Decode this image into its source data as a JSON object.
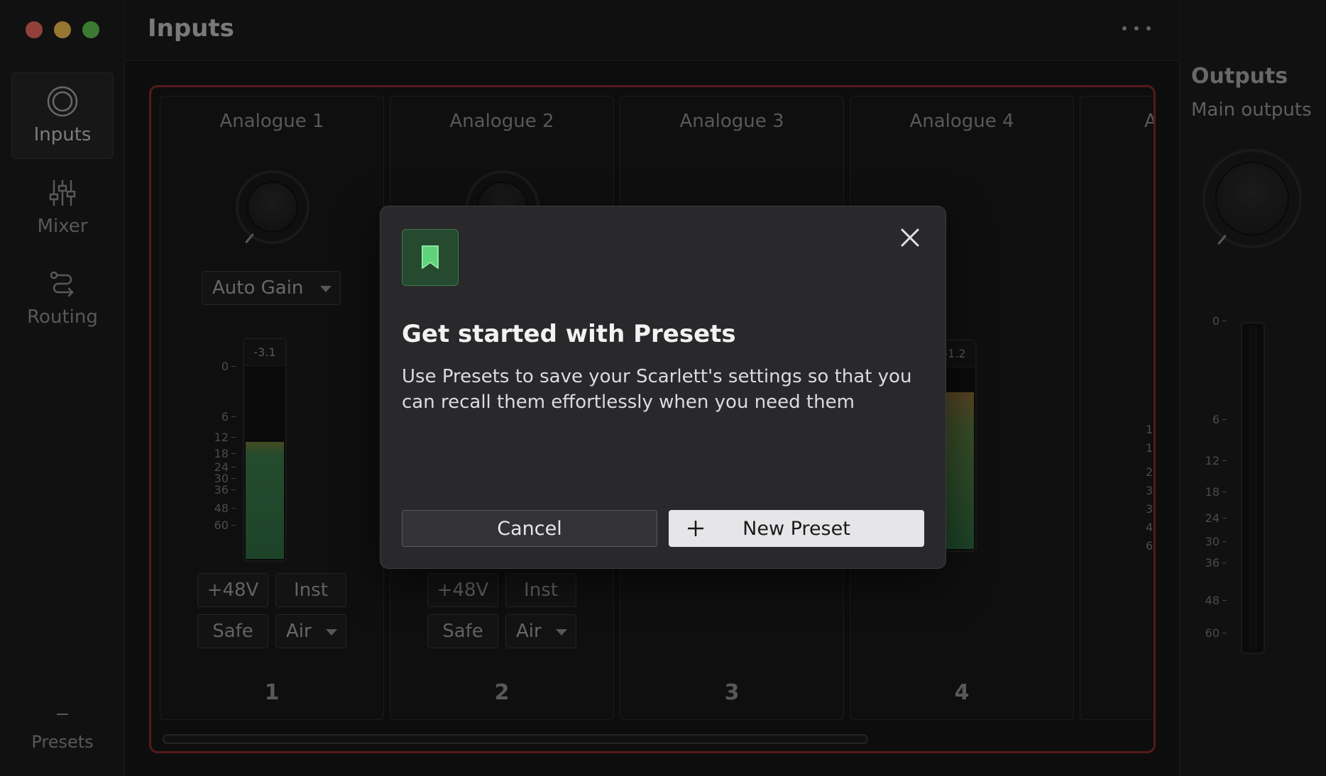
{
  "header": {
    "title": "Inputs"
  },
  "sidebar": {
    "items": [
      {
        "label": "Inputs",
        "icon": "inputs-icon",
        "active": true
      },
      {
        "label": "Mixer",
        "icon": "mixer-icon",
        "active": false
      },
      {
        "label": "Routing",
        "icon": "routing-icon",
        "active": false
      }
    ],
    "presets_label": "Presets"
  },
  "channels": [
    {
      "title": "Analogue 1",
      "number": "1",
      "gain_mode": "Auto Gain",
      "peak": "-3.1",
      "level_fraction": 0.61,
      "phantom": "+48V",
      "inst": "Inst",
      "safe": "Safe",
      "air": "Air"
    },
    {
      "title": "Analogue 2",
      "number": "2",
      "phantom": "+48V",
      "inst": "Inst",
      "safe": "Safe",
      "air": "Air"
    },
    {
      "title": "Analogue 3",
      "number": "3"
    },
    {
      "title": "Analogue 4",
      "number": "4",
      "peak": "-1.2",
      "level_fraction": 0.87
    },
    {
      "title": "A"
    }
  ],
  "meter_scale": [
    "0",
    "6",
    "12",
    "18",
    "24",
    "30",
    "36",
    "48",
    "60"
  ],
  "partial_scale": [
    "1",
    "1",
    "2",
    "3",
    "3",
    "4",
    "6"
  ],
  "outputs": {
    "title": "Outputs",
    "subtitle": "Main outputs",
    "scale": [
      "0",
      "6",
      "12",
      "18",
      "24",
      "30",
      "36",
      "48",
      "60"
    ]
  },
  "dialog": {
    "title": "Get started with Presets",
    "body": "Use Presets to save your Scarlett's settings so that you can recall them effortlessly when you need them",
    "cancel_label": "Cancel",
    "new_preset_label": "New Preset",
    "icon": "bookmark-icon"
  },
  "colors": {
    "accent_red": "#8a2b2b",
    "meter_green": "#3a7a4a",
    "dialog_icon_bg": "#254a2f"
  }
}
